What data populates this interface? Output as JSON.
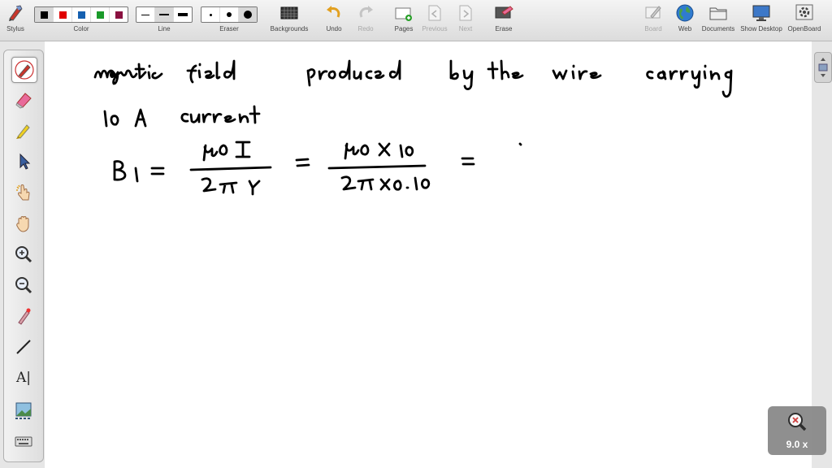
{
  "toolbar": {
    "stylus": "Stylus",
    "color": "Color",
    "line": "Line",
    "eraser": "Eraser",
    "backgrounds": "Backgrounds",
    "undo": "Undo",
    "redo": "Redo",
    "pages": "Pages",
    "previous": "Previous",
    "next": "Next",
    "erase": "Erase",
    "board": "Board",
    "web": "Web",
    "documents": "Documents",
    "show_desktop": "Show Desktop",
    "openboard": "OpenBoard"
  },
  "colors": [
    "#000000",
    "#e00000",
    "#1560b0",
    "#1a9a2a",
    "#8a1040"
  ],
  "zoom": {
    "level": "9.0 x"
  },
  "palette": {
    "text_tool_glyph": "A|"
  }
}
